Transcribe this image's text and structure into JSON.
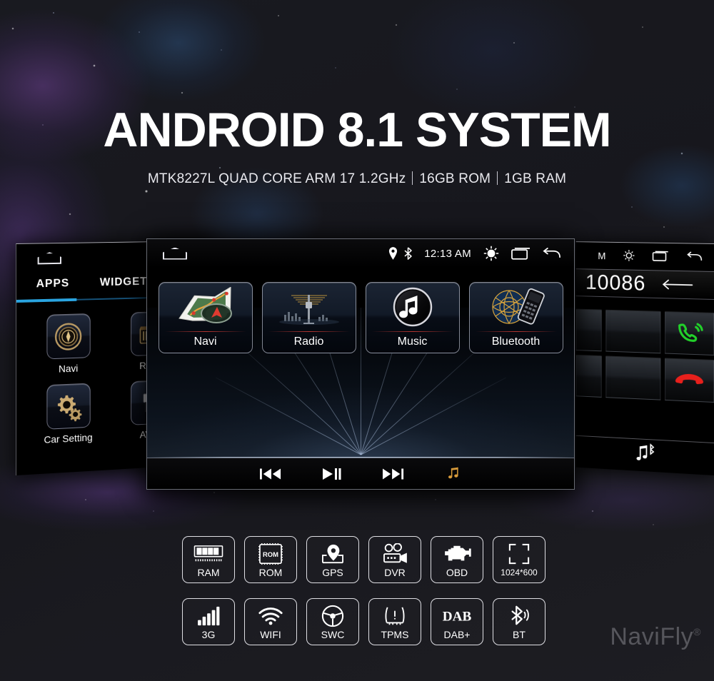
{
  "hero": {
    "title": "ANDROID 8.1 SYSTEM",
    "spec_chip": "MTK8227L QUAD CORE ARM 17 1.2GHz",
    "spec_rom": "16GB ROM",
    "spec_ram": "1GB RAM"
  },
  "device": {
    "status": {
      "home_icon": "home-icon",
      "location_icon": "location-pin-icon",
      "bluetooth_icon": "bluetooth-icon",
      "time": "12:13 AM",
      "brightness_icon": "brightness-icon",
      "recents_icon": "recents-icon",
      "back_icon": "back-arrow-icon"
    },
    "tiles": [
      {
        "label": "Navi",
        "icon": "map-navigation-icon"
      },
      {
        "label": "Radio",
        "icon": "radio-antenna-icon"
      },
      {
        "label": "Music",
        "icon": "music-note-icon"
      },
      {
        "label": "Bluetooth",
        "icon": "bluetooth-phone-icon"
      }
    ],
    "controls": [
      {
        "name": "previous-track-button",
        "glyph": "⏮"
      },
      {
        "name": "play-pause-button",
        "glyph": "▶❘"
      },
      {
        "name": "next-track-button",
        "glyph": "⏭"
      },
      {
        "name": "music-button",
        "glyph": "♫"
      }
    ]
  },
  "left_screen": {
    "home_icon": "home-icon",
    "tabs": [
      {
        "label": "APPS",
        "active": true
      },
      {
        "label": "WIDGETS",
        "active": false
      }
    ],
    "apps": [
      {
        "label": "Navi",
        "icon": "compass-icon"
      },
      {
        "label": "Radio",
        "icon": "radio-icon"
      },
      {
        "label": "Car Setting",
        "icon": "gears-icon"
      },
      {
        "label": "AV IN",
        "icon": "av-cable-icon"
      }
    ]
  },
  "right_screen": {
    "status": {
      "time_partial": "M",
      "brightness_icon": "brightness-icon",
      "recents_icon": "recents-icon",
      "back_icon": "back-arrow-icon"
    },
    "dialer": {
      "number": "10086",
      "backspace_icon": "backspace-arrow-icon",
      "call_icon": "call-icon",
      "hangup_icon": "hangup-icon"
    },
    "bottom_icon": "bluetooth-music-icon"
  },
  "badges": [
    {
      "label": "RAM",
      "icon": "ram-module-icon",
      "small": false
    },
    {
      "label": "ROM",
      "icon": "rom-chip-icon",
      "small": false
    },
    {
      "label": "GPS",
      "icon": "gps-pin-icon",
      "small": false
    },
    {
      "label": "DVR",
      "icon": "dvr-camera-icon",
      "small": false
    },
    {
      "label": "OBD",
      "icon": "obd-engine-icon",
      "small": false
    },
    {
      "label": "1024*600",
      "icon": "resolution-icon",
      "small": true
    },
    {
      "label": "3G",
      "icon": "signal-bars-icon",
      "small": false
    },
    {
      "label": "WIFI",
      "icon": "wifi-icon",
      "small": false
    },
    {
      "label": "SWC",
      "icon": "steering-wheel-icon",
      "small": false
    },
    {
      "label": "TPMS",
      "icon": "tpms-tire-icon",
      "small": false
    },
    {
      "label": "DAB+",
      "icon": "dab-logo-icon",
      "small": false
    },
    {
      "label": "BT",
      "icon": "bluetooth-icon",
      "small": false
    }
  ],
  "badge_inner_text": {
    "rom": "ROM",
    "dab": "DAB"
  },
  "watermark": {
    "text": "NaviFly",
    "mark": "®"
  },
  "colors": {
    "accent_blue": "#2aa4e0",
    "call_green": "#22d12a",
    "hangup_red": "#e8201c",
    "divider_red": "#be3732",
    "music_orange": "#d79a3a",
    "background": "#1f1f24"
  }
}
